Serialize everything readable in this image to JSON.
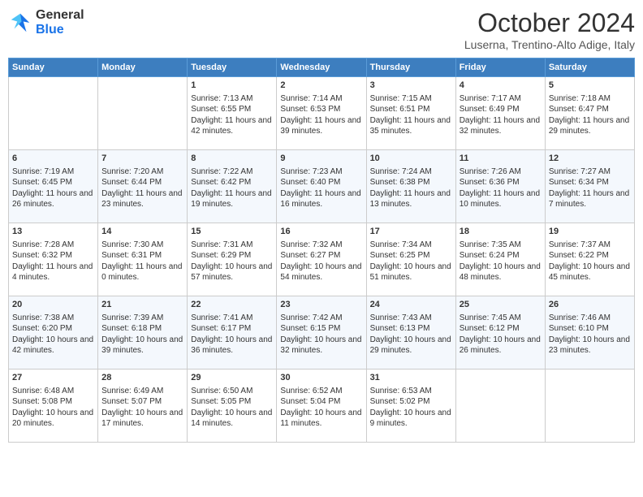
{
  "logo": {
    "line1": "General",
    "line2": "Blue"
  },
  "title": "October 2024",
  "location": "Luserna, Trentino-Alto Adige, Italy",
  "days_of_week": [
    "Sunday",
    "Monday",
    "Tuesday",
    "Wednesday",
    "Thursday",
    "Friday",
    "Saturday"
  ],
  "weeks": [
    [
      {
        "day": "",
        "sunrise": "",
        "sunset": "",
        "daylight": ""
      },
      {
        "day": "",
        "sunrise": "",
        "sunset": "",
        "daylight": ""
      },
      {
        "day": "1",
        "sunrise": "Sunrise: 7:13 AM",
        "sunset": "Sunset: 6:55 PM",
        "daylight": "Daylight: 11 hours and 42 minutes."
      },
      {
        "day": "2",
        "sunrise": "Sunrise: 7:14 AM",
        "sunset": "Sunset: 6:53 PM",
        "daylight": "Daylight: 11 hours and 39 minutes."
      },
      {
        "day": "3",
        "sunrise": "Sunrise: 7:15 AM",
        "sunset": "Sunset: 6:51 PM",
        "daylight": "Daylight: 11 hours and 35 minutes."
      },
      {
        "day": "4",
        "sunrise": "Sunrise: 7:17 AM",
        "sunset": "Sunset: 6:49 PM",
        "daylight": "Daylight: 11 hours and 32 minutes."
      },
      {
        "day": "5",
        "sunrise": "Sunrise: 7:18 AM",
        "sunset": "Sunset: 6:47 PM",
        "daylight": "Daylight: 11 hours and 29 minutes."
      }
    ],
    [
      {
        "day": "6",
        "sunrise": "Sunrise: 7:19 AM",
        "sunset": "Sunset: 6:45 PM",
        "daylight": "Daylight: 11 hours and 26 minutes."
      },
      {
        "day": "7",
        "sunrise": "Sunrise: 7:20 AM",
        "sunset": "Sunset: 6:44 PM",
        "daylight": "Daylight: 11 hours and 23 minutes."
      },
      {
        "day": "8",
        "sunrise": "Sunrise: 7:22 AM",
        "sunset": "Sunset: 6:42 PM",
        "daylight": "Daylight: 11 hours and 19 minutes."
      },
      {
        "day": "9",
        "sunrise": "Sunrise: 7:23 AM",
        "sunset": "Sunset: 6:40 PM",
        "daylight": "Daylight: 11 hours and 16 minutes."
      },
      {
        "day": "10",
        "sunrise": "Sunrise: 7:24 AM",
        "sunset": "Sunset: 6:38 PM",
        "daylight": "Daylight: 11 hours and 13 minutes."
      },
      {
        "day": "11",
        "sunrise": "Sunrise: 7:26 AM",
        "sunset": "Sunset: 6:36 PM",
        "daylight": "Daylight: 11 hours and 10 minutes."
      },
      {
        "day": "12",
        "sunrise": "Sunrise: 7:27 AM",
        "sunset": "Sunset: 6:34 PM",
        "daylight": "Daylight: 11 hours and 7 minutes."
      }
    ],
    [
      {
        "day": "13",
        "sunrise": "Sunrise: 7:28 AM",
        "sunset": "Sunset: 6:32 PM",
        "daylight": "Daylight: 11 hours and 4 minutes."
      },
      {
        "day": "14",
        "sunrise": "Sunrise: 7:30 AM",
        "sunset": "Sunset: 6:31 PM",
        "daylight": "Daylight: 11 hours and 0 minutes."
      },
      {
        "day": "15",
        "sunrise": "Sunrise: 7:31 AM",
        "sunset": "Sunset: 6:29 PM",
        "daylight": "Daylight: 10 hours and 57 minutes."
      },
      {
        "day": "16",
        "sunrise": "Sunrise: 7:32 AM",
        "sunset": "Sunset: 6:27 PM",
        "daylight": "Daylight: 10 hours and 54 minutes."
      },
      {
        "day": "17",
        "sunrise": "Sunrise: 7:34 AM",
        "sunset": "Sunset: 6:25 PM",
        "daylight": "Daylight: 10 hours and 51 minutes."
      },
      {
        "day": "18",
        "sunrise": "Sunrise: 7:35 AM",
        "sunset": "Sunset: 6:24 PM",
        "daylight": "Daylight: 10 hours and 48 minutes."
      },
      {
        "day": "19",
        "sunrise": "Sunrise: 7:37 AM",
        "sunset": "Sunset: 6:22 PM",
        "daylight": "Daylight: 10 hours and 45 minutes."
      }
    ],
    [
      {
        "day": "20",
        "sunrise": "Sunrise: 7:38 AM",
        "sunset": "Sunset: 6:20 PM",
        "daylight": "Daylight: 10 hours and 42 minutes."
      },
      {
        "day": "21",
        "sunrise": "Sunrise: 7:39 AM",
        "sunset": "Sunset: 6:18 PM",
        "daylight": "Daylight: 10 hours and 39 minutes."
      },
      {
        "day": "22",
        "sunrise": "Sunrise: 7:41 AM",
        "sunset": "Sunset: 6:17 PM",
        "daylight": "Daylight: 10 hours and 36 minutes."
      },
      {
        "day": "23",
        "sunrise": "Sunrise: 7:42 AM",
        "sunset": "Sunset: 6:15 PM",
        "daylight": "Daylight: 10 hours and 32 minutes."
      },
      {
        "day": "24",
        "sunrise": "Sunrise: 7:43 AM",
        "sunset": "Sunset: 6:13 PM",
        "daylight": "Daylight: 10 hours and 29 minutes."
      },
      {
        "day": "25",
        "sunrise": "Sunrise: 7:45 AM",
        "sunset": "Sunset: 6:12 PM",
        "daylight": "Daylight: 10 hours and 26 minutes."
      },
      {
        "day": "26",
        "sunrise": "Sunrise: 7:46 AM",
        "sunset": "Sunset: 6:10 PM",
        "daylight": "Daylight: 10 hours and 23 minutes."
      }
    ],
    [
      {
        "day": "27",
        "sunrise": "Sunrise: 6:48 AM",
        "sunset": "Sunset: 5:08 PM",
        "daylight": "Daylight: 10 hours and 20 minutes."
      },
      {
        "day": "28",
        "sunrise": "Sunrise: 6:49 AM",
        "sunset": "Sunset: 5:07 PM",
        "daylight": "Daylight: 10 hours and 17 minutes."
      },
      {
        "day": "29",
        "sunrise": "Sunrise: 6:50 AM",
        "sunset": "Sunset: 5:05 PM",
        "daylight": "Daylight: 10 hours and 14 minutes."
      },
      {
        "day": "30",
        "sunrise": "Sunrise: 6:52 AM",
        "sunset": "Sunset: 5:04 PM",
        "daylight": "Daylight: 10 hours and 11 minutes."
      },
      {
        "day": "31",
        "sunrise": "Sunrise: 6:53 AM",
        "sunset": "Sunset: 5:02 PM",
        "daylight": "Daylight: 10 hours and 9 minutes."
      },
      {
        "day": "",
        "sunrise": "",
        "sunset": "",
        "daylight": ""
      },
      {
        "day": "",
        "sunrise": "",
        "sunset": "",
        "daylight": ""
      }
    ]
  ]
}
